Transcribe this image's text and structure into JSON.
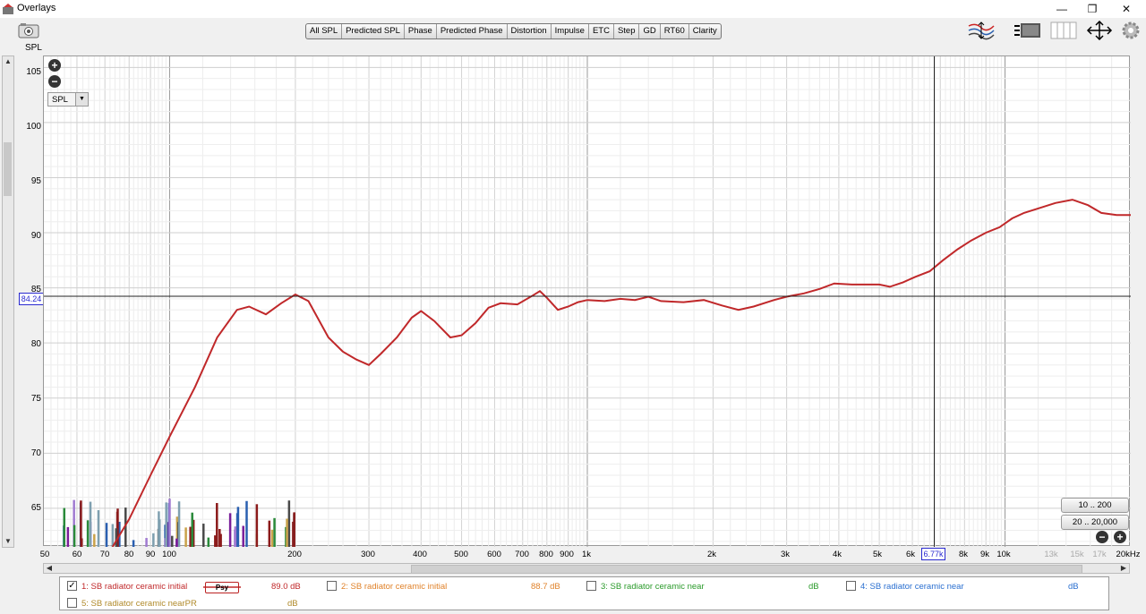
{
  "window": {
    "title": "Overlays",
    "minimize": "—",
    "restore": "❐",
    "close": "✕"
  },
  "toolbar": {
    "tabs": [
      "All SPL",
      "Predicted SPL",
      "Phase",
      "Predicted Phase",
      "Distortion",
      "Impulse",
      "ETC",
      "Step",
      "GD",
      "RT60",
      "Clarity"
    ],
    "active_tab": "All SPL",
    "icons": [
      "camera-icon",
      "overlay-curves-icon",
      "controls-panel-icon",
      "legend-columns-icon",
      "fit-arrows-icon",
      "settings-gear-icon"
    ]
  },
  "plot": {
    "y_unit": "SPL",
    "y_ticks": [
      "105",
      "100",
      "95",
      "90",
      "85",
      "80",
      "75",
      "70",
      "65"
    ],
    "cursor_y": "84.24",
    "cursor_x": "6.77k",
    "x_ticks": [
      "50",
      "60",
      "70",
      "80",
      "90",
      "100",
      "200",
      "300",
      "400",
      "500",
      "600",
      "700",
      "800",
      "900",
      "1k",
      "2k",
      "3k",
      "4k",
      "5k",
      "6k",
      "8k",
      "9k",
      "10k",
      "13k",
      "15k",
      "17k",
      "20kHz"
    ],
    "measure_select": "SPL",
    "range_buttons": [
      "10 .. 200",
      "20 .. 20,000"
    ],
    "zoom_in": "+",
    "zoom_out": "−"
  },
  "legend": {
    "items": [
      {
        "index_label": "1: SB radiator ceramic initial",
        "checked": true,
        "value": "89.0 dB",
        "smoothing": "Psy",
        "color": "#c0282a"
      },
      {
        "index_label": "2: SB radiator ceramic initial",
        "checked": false,
        "value": "88.7 dB",
        "color": "#e0822a"
      },
      {
        "index_label": "3: SB radiator ceramic near",
        "checked": false,
        "value": "dB",
        "color": "#2a9a2a"
      },
      {
        "index_label": "4: SB radiator ceramic near",
        "checked": false,
        "value": "dB",
        "color": "#2a6fd0"
      },
      {
        "index_label": "5: SB radiator ceramic nearPR",
        "checked": false,
        "value": "dB",
        "color": "#b08a2a"
      }
    ]
  },
  "chart_data": {
    "type": "line",
    "x_scale": "log",
    "xlim": [
      50,
      20000
    ],
    "ylim": [
      61.5,
      106
    ],
    "ylabel": "SPL",
    "grid": true,
    "series": [
      {
        "name": "1: SB radiator ceramic initial",
        "color": "#c0282a",
        "points": [
          [
            73,
            61.5
          ],
          [
            80,
            64
          ],
          [
            90,
            68
          ],
          [
            100,
            71.5
          ],
          [
            115,
            76
          ],
          [
            130,
            80.5
          ],
          [
            145,
            83
          ],
          [
            155,
            83.3
          ],
          [
            170,
            82.6
          ],
          [
            185,
            83.6
          ],
          [
            200,
            84.4
          ],
          [
            215,
            83.8
          ],
          [
            240,
            80.5
          ],
          [
            260,
            79.2
          ],
          [
            280,
            78.5
          ],
          [
            300,
            78
          ],
          [
            320,
            79
          ],
          [
            350,
            80.5
          ],
          [
            380,
            82.3
          ],
          [
            400,
            82.9
          ],
          [
            430,
            82
          ],
          [
            470,
            80.5
          ],
          [
            500,
            80.7
          ],
          [
            540,
            81.8
          ],
          [
            580,
            83.2
          ],
          [
            620,
            83.6
          ],
          [
            680,
            83.5
          ],
          [
            740,
            84.3
          ],
          [
            770,
            84.7
          ],
          [
            800,
            84.1
          ],
          [
            850,
            83
          ],
          [
            900,
            83.3
          ],
          [
            950,
            83.7
          ],
          [
            1000,
            83.9
          ],
          [
            1100,
            83.8
          ],
          [
            1200,
            84
          ],
          [
            1300,
            83.9
          ],
          [
            1400,
            84.2
          ],
          [
            1500,
            83.8
          ],
          [
            1700,
            83.7
          ],
          [
            1900,
            83.9
          ],
          [
            2100,
            83.4
          ],
          [
            2300,
            83
          ],
          [
            2500,
            83.3
          ],
          [
            2800,
            83.9
          ],
          [
            3000,
            84.2
          ],
          [
            3300,
            84.5
          ],
          [
            3600,
            84.9
          ],
          [
            3900,
            85.4
          ],
          [
            4300,
            85.3
          ],
          [
            4700,
            85.3
          ],
          [
            5000,
            85.3
          ],
          [
            5300,
            85.1
          ],
          [
            5700,
            85.5
          ],
          [
            6100,
            86
          ],
          [
            6600,
            86.5
          ],
          [
            7100,
            87.5
          ],
          [
            7700,
            88.5
          ],
          [
            8300,
            89.3
          ],
          [
            9000,
            90
          ],
          [
            9700,
            90.5
          ],
          [
            10400,
            91.3
          ],
          [
            11100,
            91.8
          ],
          [
            12000,
            92.2
          ],
          [
            13200,
            92.7
          ],
          [
            14500,
            93
          ],
          [
            15800,
            92.5
          ],
          [
            17000,
            91.8
          ],
          [
            18500,
            91.6
          ],
          [
            20000,
            91.6
          ]
        ]
      }
    ],
    "distortion_bars": {
      "x_range_hz": [
        55,
        200
      ],
      "colors": [
        "#c9a24a",
        "#8b1a1a",
        "#7a1f9a",
        "#2a8a3a",
        "#2a5fb0",
        "#7fa0b0",
        "#4a4a4a",
        "#a07ad0"
      ]
    },
    "cursor": {
      "x": 6770,
      "y": 84.24
    }
  }
}
